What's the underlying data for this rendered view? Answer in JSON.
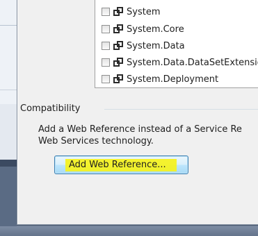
{
  "references": [
    {
      "name": "System",
      "checked": false
    },
    {
      "name": "System.Core",
      "checked": false
    },
    {
      "name": "System.Data",
      "checked": false
    },
    {
      "name": "System.Data.DataSetExtensio",
      "checked": false
    },
    {
      "name": "System.Deployment",
      "checked": false
    }
  ],
  "icons": {
    "reference": "assembly-icon",
    "checkbox": "checkbox-unchecked"
  },
  "compatibility": {
    "title": "Compatibility",
    "description_line1": "Add a Web Reference instead of a Service Re",
    "description_line2": "Web Services technology."
  },
  "button": {
    "label": "Add Web Reference...",
    "highlight_color": "#f5f21c"
  }
}
